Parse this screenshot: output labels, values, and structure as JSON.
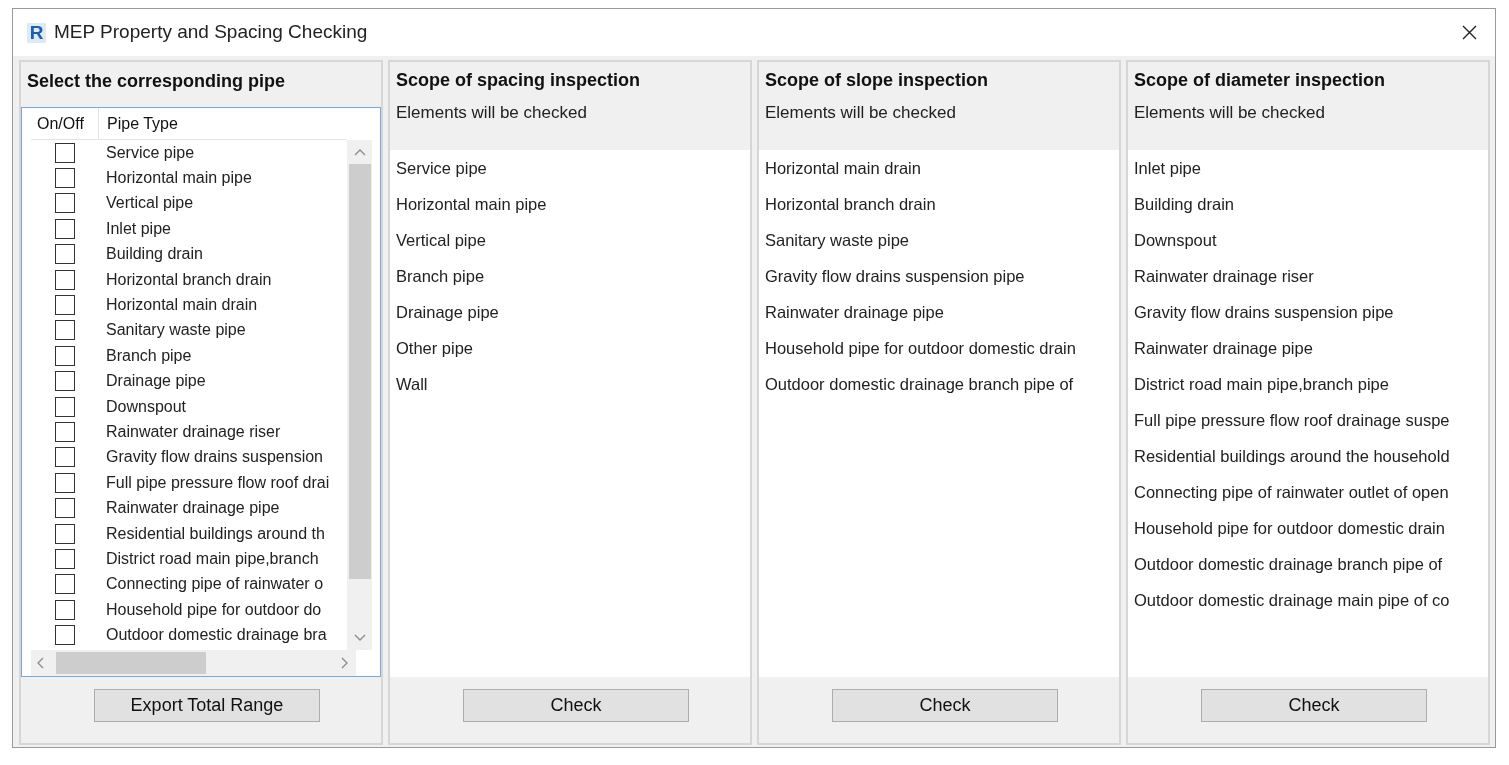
{
  "window": {
    "icon_letter": "R",
    "title": "MEP Property and Spacing Checking"
  },
  "pipe_panel": {
    "title": "Select the corresponding pipe",
    "columns": [
      "On/Off",
      "Pipe Type"
    ],
    "rows": [
      {
        "label": "Service pipe",
        "checked": false
      },
      {
        "label": "Horizontal main pipe",
        "checked": false
      },
      {
        "label": "Vertical pipe",
        "checked": false
      },
      {
        "label": "Inlet pipe",
        "checked": false
      },
      {
        "label": "Building drain",
        "checked": false
      },
      {
        "label": "Horizontal branch drain",
        "checked": false
      },
      {
        "label": "Horizontal main drain",
        "checked": false
      },
      {
        "label": "Sanitary waste pipe",
        "checked": false
      },
      {
        "label": "Branch pipe",
        "checked": false
      },
      {
        "label": "Drainage pipe",
        "checked": false
      },
      {
        "label": "Downspout",
        "checked": false
      },
      {
        "label": "Rainwater drainage riser",
        "checked": false
      },
      {
        "label": "Gravity flow drains suspension",
        "checked": false
      },
      {
        "label": "Full pipe pressure flow roof drai",
        "checked": false
      },
      {
        "label": "Rainwater drainage pipe",
        "checked": false
      },
      {
        "label": "Residential buildings around th",
        "checked": false
      },
      {
        "label": "District road main pipe,branch",
        "checked": false
      },
      {
        "label": "Connecting pipe of rainwater o",
        "checked": false
      },
      {
        "label": "Household pipe for outdoor do",
        "checked": false
      },
      {
        "label": "Outdoor domestic drainage bra",
        "checked": false
      }
    ],
    "button": "Export Total Range"
  },
  "inspection_panels": [
    {
      "title": "Scope of spacing inspection",
      "subtitle": "Elements will be checked",
      "items": [
        "Service pipe",
        "Horizontal main pipe",
        "Vertical pipe",
        "Branch pipe",
        "Drainage pipe",
        "Other pipe",
        "Wall"
      ],
      "button": "Check"
    },
    {
      "title": "Scope of slope inspection",
      "subtitle": "Elements will be checked",
      "items": [
        "Horizontal main drain",
        "Horizontal branch drain",
        "Sanitary waste pipe",
        "Gravity flow drains suspension pipe",
        "Rainwater drainage pipe",
        "Household pipe for outdoor domestic drain",
        "Outdoor domestic drainage branch pipe of"
      ],
      "button": "Check"
    },
    {
      "title": "Scope of diameter inspection",
      "subtitle": "Elements will be checked",
      "items": [
        "Inlet pipe",
        "Building drain",
        "Downspout",
        "Rainwater drainage riser",
        "Gravity flow drains suspension pipe",
        "Rainwater drainage pipe",
        "District road main pipe,branch pipe",
        "Full pipe pressure flow roof drainage suspe",
        "Residential buildings around the household",
        "Connecting pipe of rainwater outlet of open",
        "Household pipe for outdoor domestic drain",
        "Outdoor domestic drainage branch pipe of",
        "Outdoor domestic drainage main pipe of co"
      ],
      "button": "Check"
    }
  ]
}
